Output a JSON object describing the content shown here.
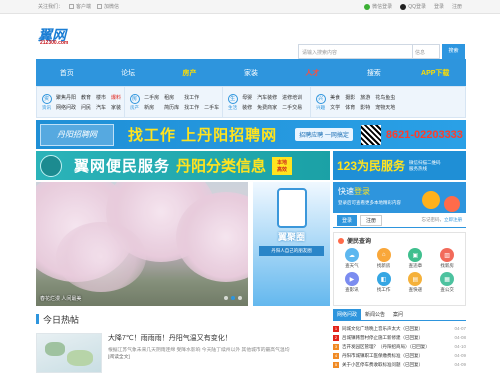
{
  "topbar": {
    "label": "关注我们：",
    "app_text": "客户端",
    "weibo_text": "加微信",
    "wechat_login": "微信登录",
    "qq_login": "QQ登录",
    "login": "登录",
    "register": "注册"
  },
  "logo": {
    "mark": "翼网",
    "domain": "212300.com"
  },
  "search": {
    "placeholder": "请输入搜索内容",
    "select": "信息",
    "button": "搜索"
  },
  "nav": [
    "首页",
    "论坛",
    "房产",
    "家装",
    "人才",
    "搜索",
    "APP下载"
  ],
  "subnav": [
    {
      "icon": "资",
      "title": "资讯",
      "links": [
        "聚焦丹阳",
        "教育",
        "楼市",
        "爆料",
        "网络问政",
        "问民",
        "汽车",
        "家装"
      ],
      "red": [
        3
      ]
    },
    {
      "icon": "房",
      "title": "房产",
      "links": [
        "二手房",
        "租房",
        "找工作",
        "",
        "新房",
        "简历库",
        "找工作",
        "二手车"
      ],
      "red": []
    },
    {
      "icon": "生",
      "title": "生活",
      "links": [
        "母婴",
        "汽车装修",
        "进修培训",
        "",
        "装修",
        "免费商家",
        "二手交易",
        ""
      ],
      "red": []
    },
    {
      "icon": "兴",
      "title": "兴趣",
      "links": [
        "美食",
        "摄影",
        "旅游",
        "花鸟鱼虫",
        "文学",
        "体育",
        "影特",
        "宠物天地"
      ],
      "red": []
    }
  ],
  "banner1": {
    "logo": "丹阳招聘网",
    "title": "找工作 上丹阳招聘网",
    "sub": "招聘应聘 一网搞定",
    "tel": "8621-02203333"
  },
  "banner2": {
    "title": "翼网便民服务",
    "sub": "丹阳分类信息",
    "badge": "本地 高效"
  },
  "banner3": {
    "title": "123为民服务",
    "sub": "微信扫描二维码<br>服务热线"
  },
  "hero": {
    "caption": "春花烂漫 人间最美"
  },
  "promo": {
    "title": "翼聚圈",
    "sub": "丹阳人自己的朋友圈"
  },
  "login": {
    "title": "快速",
    "title_b": "登录",
    "sub": "登录后可查看更多本地精彩内容",
    "btn_login": "登录",
    "btn_reg": "注册",
    "forget": "忘记密码，",
    "now_reg": "立即注册"
  },
  "conv": {
    "title": "便民查询",
    "items": [
      {
        "label": "查天气",
        "color": "#5db7ef"
      },
      {
        "label": "找新房",
        "color": "#f9a73a"
      },
      {
        "label": "查违章",
        "color": "#3fbf8e"
      },
      {
        "label": "找新房",
        "color": "#f26a5a"
      },
      {
        "label": "查影讯",
        "color": "#7b8cf0"
      },
      {
        "label": "找工作",
        "color": "#35a6e3"
      },
      {
        "label": "查快递",
        "color": "#f5b13a"
      },
      {
        "label": "查公交",
        "color": "#4cc29f"
      }
    ]
  },
  "section": {
    "title": "今日热帖"
  },
  "feed": {
    "title": "大降7℃！雨雨雨！丹阳气温又有变化！",
    "desc": "根据江苏气象未来几天阴雨连绵 受降水影响 今天陆丁续州以外 其他城市的最高气温均",
    "tag": "[阅读全文]"
  },
  "news": {
    "tabs": [
      "网络问政",
      "新闻公告",
      "案问"
    ],
    "items": [
      {
        "n": "1",
        "t": "同城文化广场晚上音乐声太大（已回复）",
        "d": "04-07"
      },
      {
        "n": "2",
        "t": "吕城镇韩营村停止施工新修建（已回复）",
        "d": "04-08"
      },
      {
        "n": "3",
        "t": "吉开发园区管理？（丹阳招商局）（已回复）",
        "d": "04-10"
      },
      {
        "n": "4",
        "t": "丹阳市城镇职工医保缴费标准（已回复）",
        "d": "04-09"
      },
      {
        "n": "5",
        "t": "关于小区停车费收取标准问题（已回复）",
        "d": "04-09"
      }
    ]
  }
}
